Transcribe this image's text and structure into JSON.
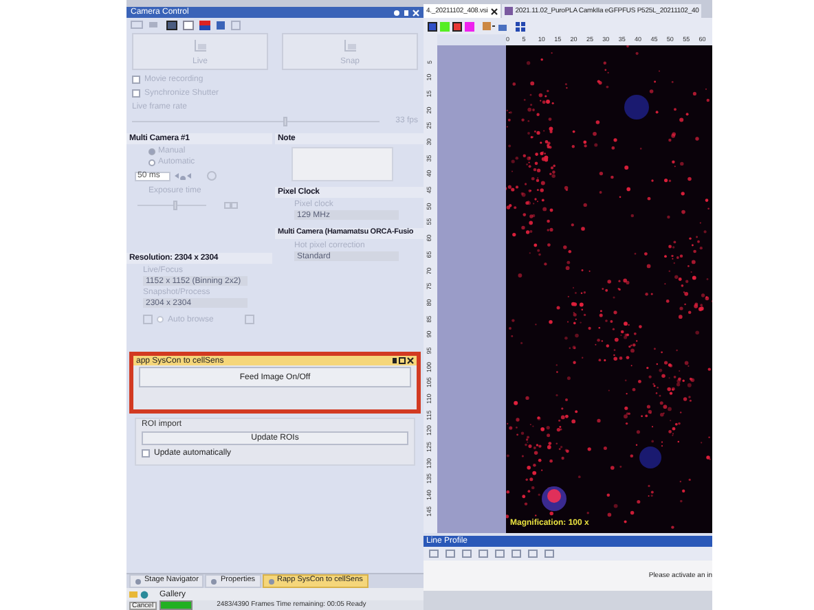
{
  "camera_control": {
    "title": "Camera Control",
    "disabled": true,
    "capture_buttons": [
      {
        "label": "Live"
      },
      {
        "label": "Snap"
      }
    ],
    "options": [
      {
        "label": "Movie recording",
        "checked": false
      },
      {
        "label": "Synchronize Shutter",
        "checked": false
      }
    ],
    "frame_rate": {
      "label": "Live frame rate",
      "level": 0.62,
      "reading": "33 fps"
    },
    "multi_camera": {
      "title": "Multi Camera #1",
      "modes": [
        {
          "label": "Manual",
          "selected": true
        },
        {
          "label": "Automatic",
          "selected": false
        }
      ],
      "exposure_value": "50 ms",
      "exposure_label": "Exposure time",
      "exposure_slider": {
        "level": 0.55
      }
    },
    "resolution": {
      "title": "Resolution: 2304 x 2304",
      "fields": [
        {
          "label": "Live/Focus",
          "value": "1152 x 1152 (Binning 2x2)"
        },
        {
          "label": "Snapshot/Process",
          "value": "2304 x 2304"
        }
      ],
      "auto": {
        "label": "Auto browse",
        "checked": false
      }
    },
    "note": {
      "title": "Note"
    },
    "pixel_clock": {
      "title": "Pixel Clock",
      "label": "Pixel clock",
      "value": "129 MHz"
    },
    "hamamatsu": {
      "title": "Multi Camera (Hamamatsu ORCA-Fusio",
      "label": "Hot pixel correction",
      "value": "Standard"
    }
  },
  "syscon_panel": {
    "title": "app SysCon to cellSens",
    "button": "Feed Image On/Off"
  },
  "roi_import": {
    "title": "ROI import",
    "button": "Update ROIs",
    "checkbox": {
      "label": "Update automatically",
      "checked": false
    }
  },
  "bottom_tabs": [
    {
      "label": "Stage Navigator",
      "selected": false
    },
    {
      "label": "Properties",
      "selected": false
    },
    {
      "label": "Rapp SysCon to cellSens",
      "selected": true
    }
  ],
  "gallery": {
    "label": "Gallery"
  },
  "status_bar": {
    "cancel": "Cancel",
    "level": 1,
    "text": "2483/4390 Frames   Time remaining: 00:05   Ready"
  },
  "viewer": {
    "tabs": [
      {
        "label": "4._20211102_408.vsi",
        "selected": true
      },
      {
        "label": "2021.11.02_PuroPLA CamkIIa eGFPFUS P525L_20211102_40",
        "selected": false
      }
    ],
    "channels": [
      {
        "color": "#3050c8",
        "selected": true
      },
      {
        "color": "#55ee22",
        "selected": false
      },
      {
        "color": "#e83838",
        "selected": true
      },
      {
        "color": "#ee22ee",
        "selected": false
      }
    ],
    "x_ticks": [
      "0",
      "5",
      "10",
      "15",
      "20",
      "25",
      "30",
      "35",
      "40",
      "45",
      "50",
      "55",
      "60"
    ],
    "y_ticks": [
      "5",
      "10",
      "15",
      "20",
      "25",
      "30",
      "35",
      "40",
      "45",
      "50",
      "55",
      "60",
      "65",
      "70",
      "75",
      "80",
      "85",
      "90",
      "95",
      "100",
      "105",
      "110",
      "115",
      "120",
      "125",
      "130",
      "135",
      "140",
      "145"
    ],
    "magnification": "Magnification:  100 x"
  },
  "line_profile": {
    "title": "Line Profile",
    "message": "Please activate an in"
  }
}
